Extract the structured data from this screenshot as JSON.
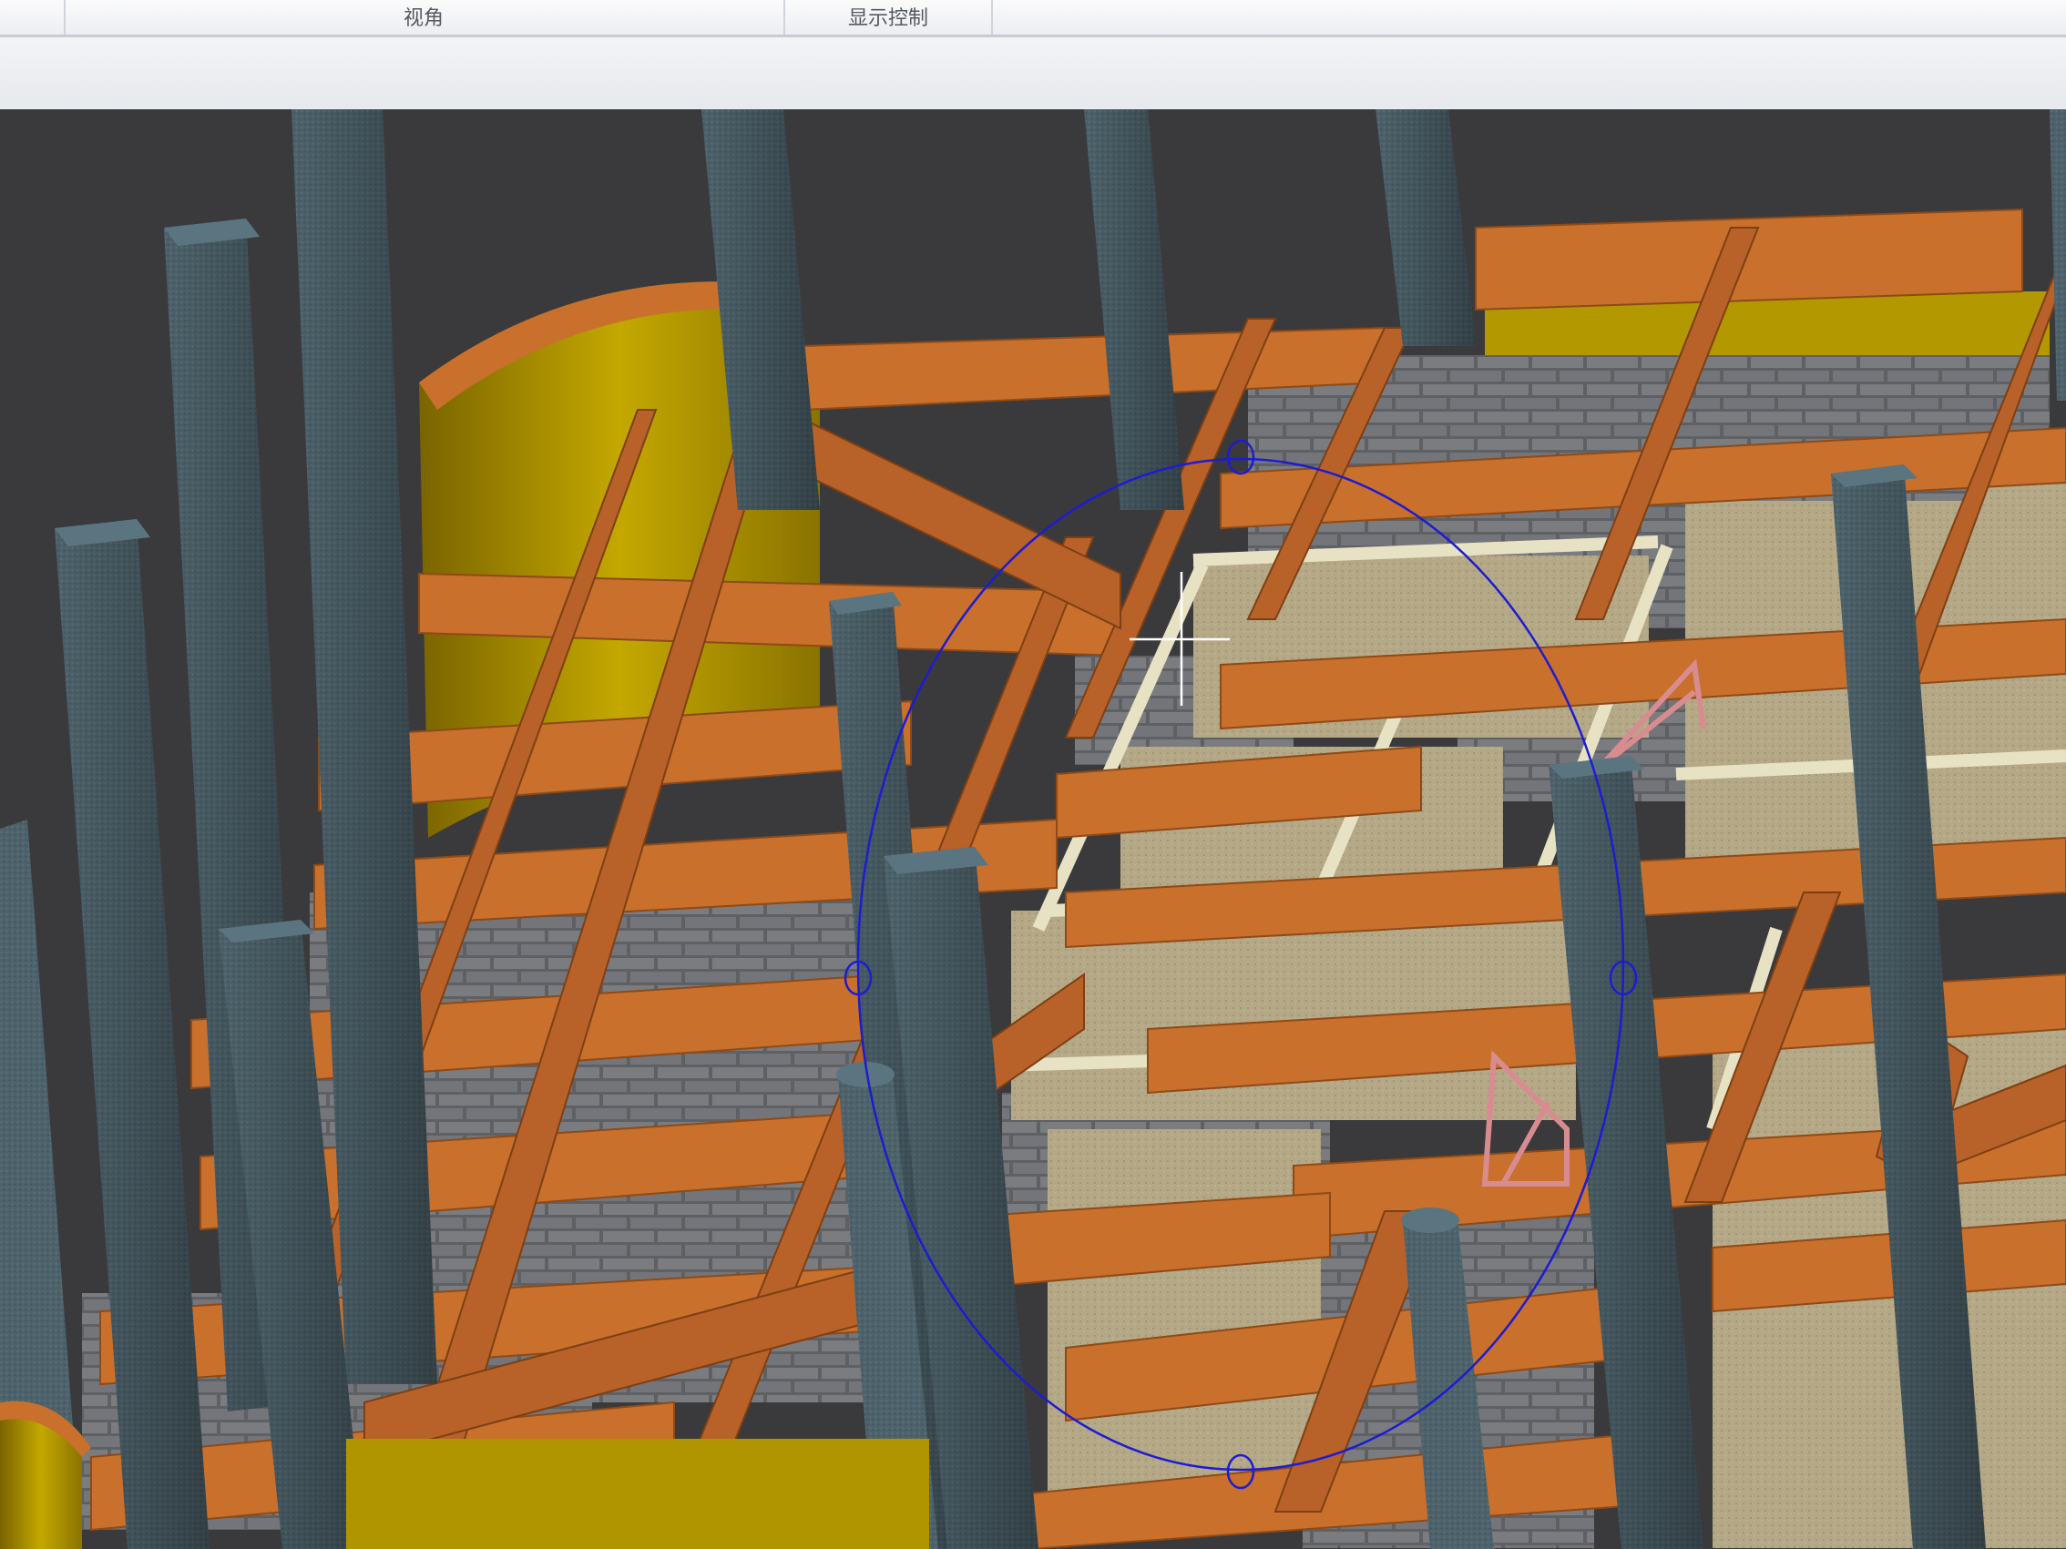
{
  "ribbon": {
    "groups": [
      {
        "label": "视角"
      },
      {
        "label": "显示控制"
      }
    ]
  },
  "viewport": {
    "background_color": "#3a3a3c",
    "materials": {
      "beam": "#c8702c",
      "column": "#4b5e66",
      "brick_wall": "#6f7073",
      "plaster_wall": "#b8ab8a",
      "slab_edge": "#e8e2c4",
      "curved_wall": "#b79b00",
      "stair": "#d98c90"
    },
    "orbit_gizmo_color": "#1c1cd2"
  }
}
